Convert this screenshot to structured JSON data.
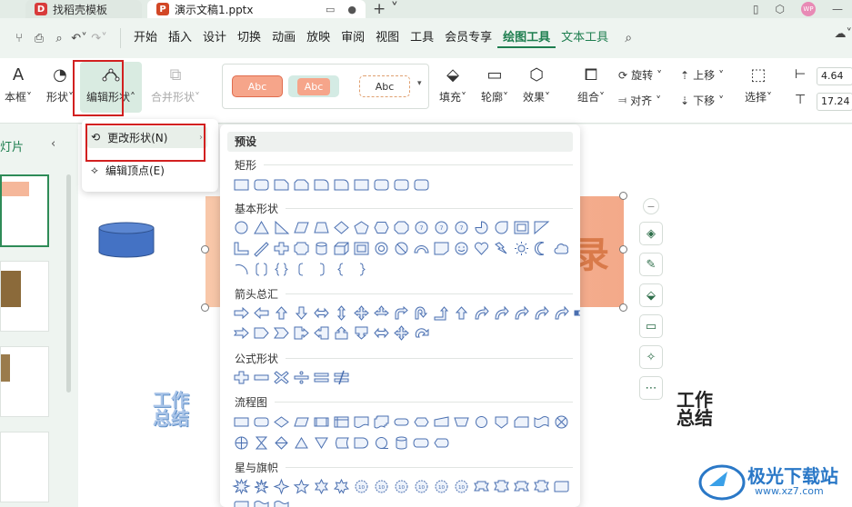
{
  "tabs": [
    {
      "label": "找稻壳模板",
      "icon": "D"
    },
    {
      "label": "演示文稿1.pptx",
      "icon": "P"
    }
  ],
  "avatar_text": "WP",
  "menus": [
    "开始",
    "插入",
    "设计",
    "切换",
    "动画",
    "放映",
    "审阅",
    "视图",
    "工具",
    "会员专享",
    "绘图工具",
    "文本工具"
  ],
  "ribbon": {
    "textbox": "本框",
    "shape": "形状",
    "edit_shape": "编辑形状",
    "merge_shape": "合并形状",
    "style_labels": [
      "Abc",
      "Abc",
      "Abc"
    ],
    "fill": "填充",
    "outline": "轮廓",
    "effect": "效果",
    "group": "组合",
    "rotate": "旋转",
    "align": "对齐",
    "bring_forward": "上移",
    "send_backward": "下移",
    "select": "选择",
    "width_value": "4.64",
    "height_value": "17.24"
  },
  "left_panel": {
    "title": "灯片"
  },
  "edit_menu": {
    "items": [
      {
        "label": "更改形状(N)"
      },
      {
        "label": "编辑顶点(E)"
      }
    ]
  },
  "shapes_panel": {
    "header": "预设",
    "categories": [
      "矩形",
      "基本形状",
      "箭头总汇",
      "公式形状",
      "流程图",
      "星与旗帜"
    ]
  },
  "canvas": {
    "word_art_left": [
      "工作",
      "总结"
    ],
    "word_art_right": [
      "工作",
      "总结"
    ],
    "big_char": "录"
  },
  "watermark": {
    "text": "极光下载站",
    "sub": "www.xz7.com"
  }
}
